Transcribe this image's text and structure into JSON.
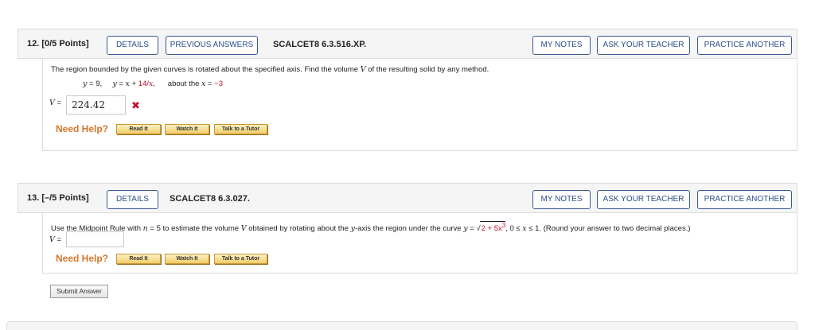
{
  "q12": {
    "number": "12. [0/5 Points]",
    "details_label": "DETAILS",
    "previous_answers_label": "PREVIOUS ANSWERS",
    "code": "SCALCET8 6.3.516.XP.",
    "my_notes_label": "MY NOTES",
    "ask_teacher_label": "ASK YOUR TEACHER",
    "practice_another_label": "PRACTICE ANOTHER",
    "prompt_before": "The region bounded by the given curves is rotated about the specified axis. Find the volume ",
    "prompt_var": "V",
    "prompt_after": " of the resulting solid by any method.",
    "eq1_lhs": "y",
    "eq1_rhs": " = 9,",
    "eq2_lhs": "y",
    "eq2_mid": " = ",
    "eq2_x": "x",
    "eq2_plus": " + ",
    "eq2_red": "14",
    "eq2_slash": "/",
    "eq2_x2": "x",
    "eq2_comma": ",",
    "about_text": "about the ",
    "about_x": "x",
    "about_eq": " = ",
    "about_val": "−3",
    "answer_label_var": "V",
    "answer_label_eq": " =",
    "answer_value": "224.42",
    "status": "incorrect",
    "need_help": "Need Help?",
    "read_it": "Read It",
    "watch_it": "Watch It",
    "talk_to_tutor": "Talk to a Tutor"
  },
  "q13": {
    "number": "13. [–/5 Points]",
    "details_label": "DETAILS",
    "code": "SCALCET8 6.3.027.",
    "my_notes_label": "MY NOTES",
    "ask_teacher_label": "ASK YOUR TEACHER",
    "practice_another_label": "PRACTICE ANOTHER",
    "prompt_a": "Use the Midpoint Rule with ",
    "prompt_n": "n",
    "prompt_b": " = 5 to estimate the volume ",
    "prompt_v": "V",
    "prompt_c": " obtained by rotating about the ",
    "prompt_y": "y",
    "prompt_d": "-axis the region under the curve ",
    "prompt_y2": "y",
    "prompt_e": " = ",
    "sqrt_sym": "√",
    "sqrt_red": "2 + 5x",
    "sqrt_exp": "3",
    "prompt_f": ", 0 ≤ ",
    "prompt_x": "x",
    "prompt_g": " ≤ 1. (Round your answer to two decimal places.)",
    "answer_label_var": "V",
    "answer_label_eq": " =",
    "answer_placeholder": "",
    "need_help": "Need Help?",
    "read_it": "Read It",
    "watch_it": "Watch It",
    "talk_to_tutor": "Talk to a Tutor",
    "submit_label": "Submit Answer"
  },
  "colors": {
    "accent_blue": "#2d4f8a",
    "error_red": "#c8102e",
    "need_help_orange": "#d5772b"
  }
}
